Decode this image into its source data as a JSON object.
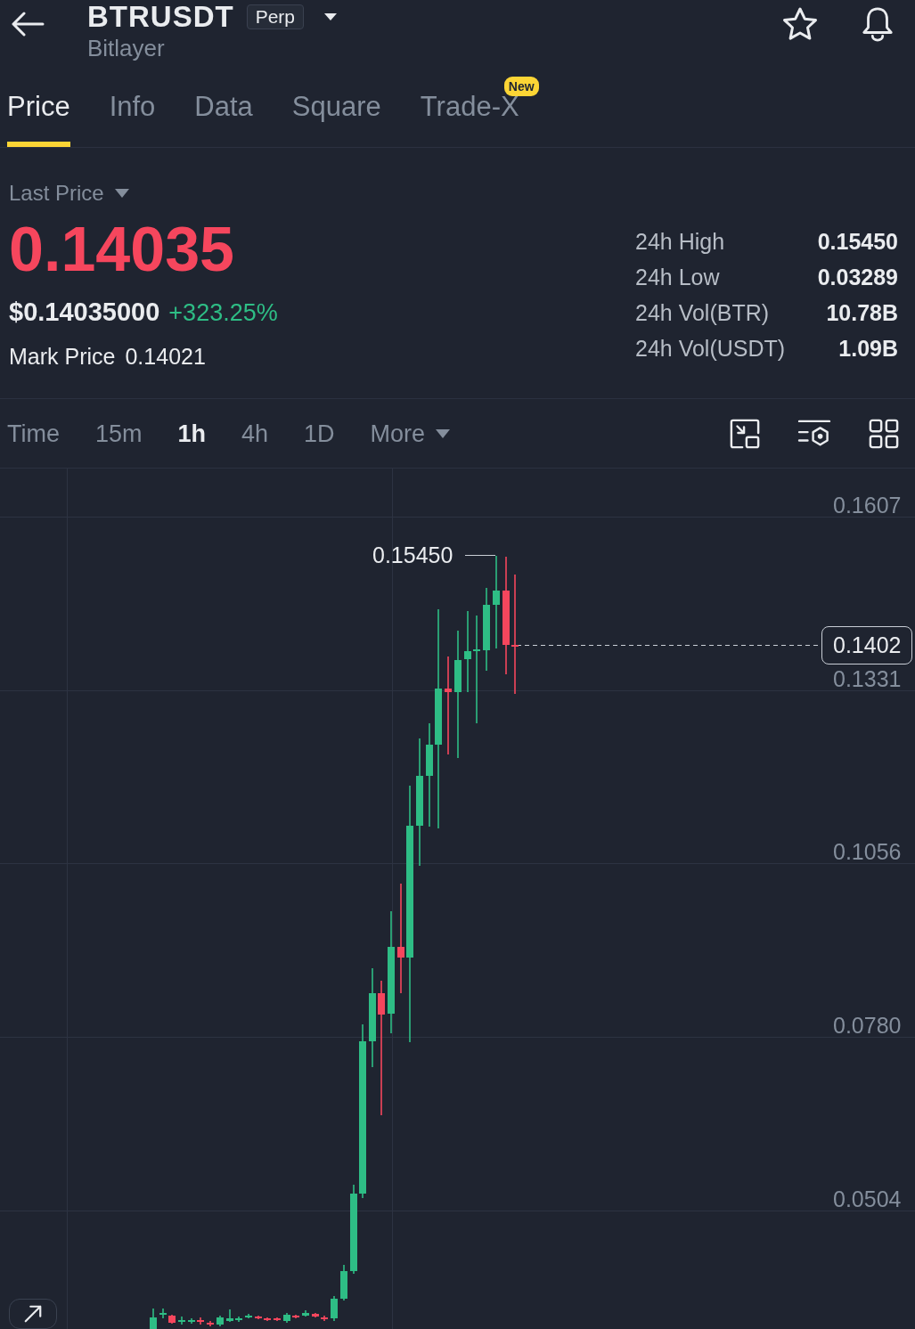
{
  "header": {
    "title": "BTRUSDT",
    "badge": "Perp",
    "subtitle": "Bitlayer"
  },
  "tabs": [
    {
      "label": "Price",
      "selected": true
    },
    {
      "label": "Info",
      "selected": false
    },
    {
      "label": "Data",
      "selected": false
    },
    {
      "label": "Square",
      "selected": false
    },
    {
      "label": "Trade-X",
      "selected": false,
      "badge": "New"
    }
  ],
  "price": {
    "selector": "Last Price",
    "last_price": "0.14035",
    "last_price_falling": true,
    "usd_price": "$0.14035000",
    "change": "+323.25%",
    "change_positive": true,
    "mark_price_label": "Mark Price",
    "mark_price": "0.14021"
  },
  "stats": [
    {
      "label": "24h High",
      "value": "0.15450"
    },
    {
      "label": "24h Low",
      "value": "0.03289"
    },
    {
      "label": "24h Vol(BTR)",
      "value": "10.78B"
    },
    {
      "label": "24h Vol(USDT)",
      "value": "1.09B"
    }
  ],
  "intervals": [
    {
      "label": "Time",
      "selected": false,
      "kind": "interval"
    },
    {
      "label": "15m",
      "selected": false,
      "kind": "interval"
    },
    {
      "label": "1h",
      "selected": true,
      "kind": "interval"
    },
    {
      "label": "4h",
      "selected": false,
      "kind": "interval"
    },
    {
      "label": "1D",
      "selected": false,
      "kind": "interval"
    },
    {
      "label": "More",
      "selected": false,
      "kind": "dropdown"
    }
  ],
  "chart": {
    "y_axis_labels": [
      "0.1607",
      "0.1331",
      "0.1056",
      "0.0780",
      "0.0504"
    ],
    "high_label": "0.15450",
    "current_price_tag": "0.1402"
  }
}
